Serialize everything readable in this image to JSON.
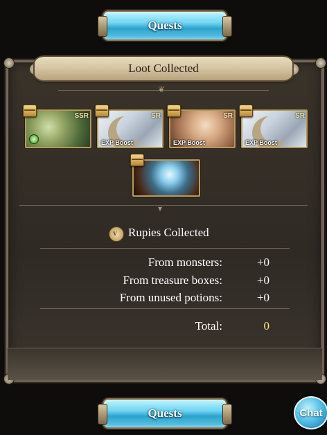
{
  "top_button": {
    "label": "Quests"
  },
  "bottom_button": {
    "label": "Quests"
  },
  "panel": {
    "title": "Loot Collected"
  },
  "loot_items": [
    {
      "name": "character-card",
      "rarity": "SSR",
      "tag": ""
    },
    {
      "name": "exp-boost-item",
      "rarity": "SR",
      "tag": "EXP Boost"
    },
    {
      "name": "character-card",
      "rarity": "SR",
      "tag": "EXP Boost"
    },
    {
      "name": "exp-boost-item",
      "rarity": "SR",
      "tag": "EXP Boost"
    },
    {
      "name": "summon-item",
      "rarity": "",
      "tag": ""
    }
  ],
  "rupies": {
    "heading": "Rupies Collected",
    "rows": [
      {
        "label": "From monsters:",
        "value": "+0"
      },
      {
        "label": "From treasure boxes:",
        "value": "+0"
      },
      {
        "label": "From unused potions:",
        "value": "+0"
      }
    ],
    "total_label": "Total:",
    "total_value": "0"
  },
  "chat": {
    "label": "Chat"
  }
}
